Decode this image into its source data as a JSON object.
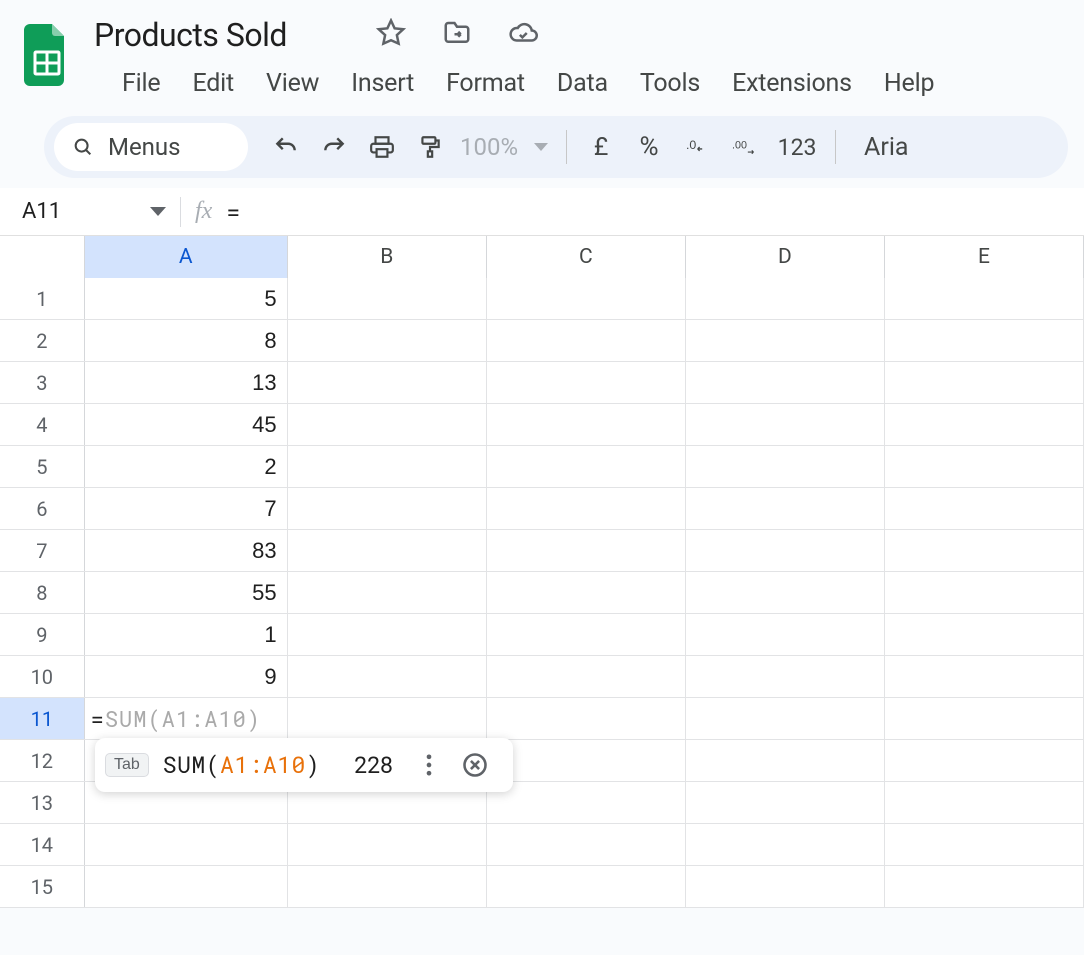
{
  "doc": {
    "title": "Products Sold"
  },
  "menu": {
    "file": "File",
    "edit": "Edit",
    "view": "View",
    "insert": "Insert",
    "format": "Format",
    "data": "Data",
    "tools": "Tools",
    "extensions": "Extensions",
    "help": "Help"
  },
  "toolbar": {
    "menus": "Menus",
    "zoom": "100%",
    "currency": "£",
    "percent": "%",
    "decrease_decimal": ".0",
    "increase_decimal": ".00",
    "number_format": "123",
    "font": "Aria"
  },
  "formula_bar": {
    "name_box": "A11",
    "fx": "fx",
    "formula": "="
  },
  "grid": {
    "columns": [
      "A",
      "B",
      "C",
      "D",
      "E"
    ],
    "active_column": "A",
    "active_row": 11,
    "rows": [
      {
        "n": 1,
        "a": "5"
      },
      {
        "n": 2,
        "a": "8"
      },
      {
        "n": 3,
        "a": "13"
      },
      {
        "n": 4,
        "a": "45"
      },
      {
        "n": 5,
        "a": "2"
      },
      {
        "n": 6,
        "a": "7"
      },
      {
        "n": 7,
        "a": "83"
      },
      {
        "n": 8,
        "a": "55"
      },
      {
        "n": 9,
        "a": "1"
      },
      {
        "n": 10,
        "a": "9"
      },
      {
        "n": 11,
        "a": ""
      },
      {
        "n": 12,
        "a": ""
      },
      {
        "n": 13,
        "a": ""
      },
      {
        "n": 14,
        "a": ""
      },
      {
        "n": 15,
        "a": ""
      }
    ],
    "editing": {
      "row": 11,
      "eq": "=",
      "ghost": "SUM(A1:A10)"
    }
  },
  "suggestion": {
    "tab_hint": "Tab",
    "func": "SUM(",
    "range": "A1:A10",
    "close": ")",
    "result": "228"
  }
}
